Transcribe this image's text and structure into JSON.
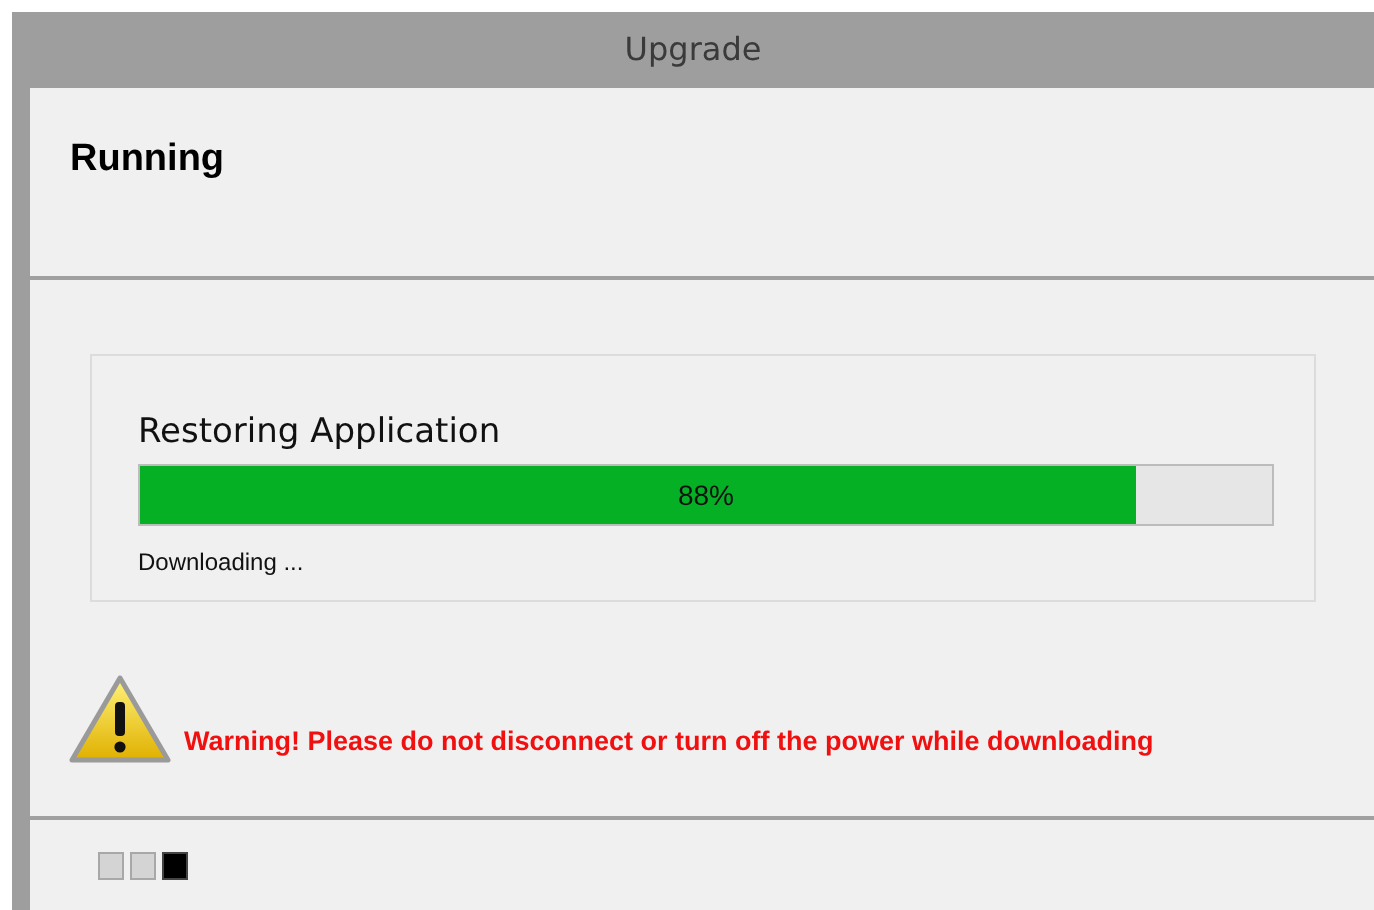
{
  "window": {
    "title": "Upgrade"
  },
  "header": {
    "title": "Running"
  },
  "task": {
    "title": "Restoring Application",
    "level": 0.88,
    "reading": "88%",
    "status": "Downloading ..."
  },
  "warning": {
    "text": "Warning! Please do not disconnect or turn off the power while downloading"
  },
  "steps": [
    {
      "selected": false
    },
    {
      "selected": false
    },
    {
      "selected": true
    }
  ]
}
